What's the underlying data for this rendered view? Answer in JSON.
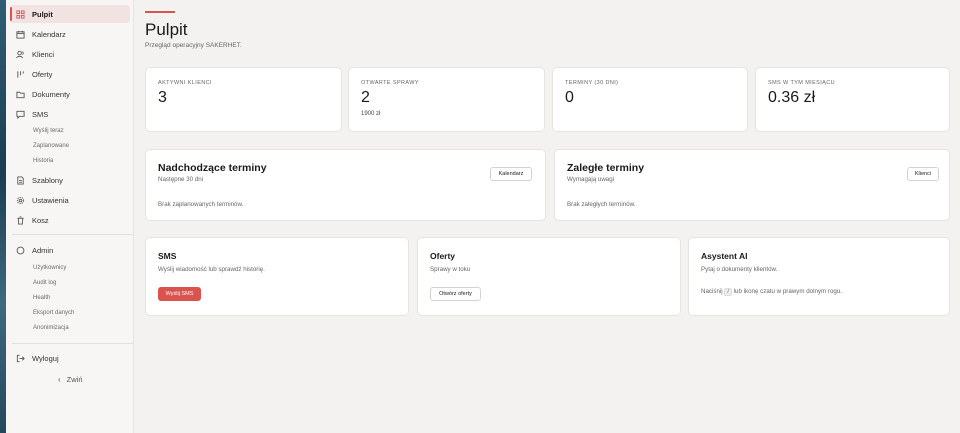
{
  "sidebar": {
    "items": [
      {
        "label": "Pulpit",
        "icon": "dashboard-icon"
      },
      {
        "label": "Kalendarz",
        "icon": "calendar-icon"
      },
      {
        "label": "Klienci",
        "icon": "users-icon"
      },
      {
        "label": "Oferty",
        "icon": "offers-icon"
      },
      {
        "label": "Dokumenty",
        "icon": "folder-icon"
      },
      {
        "label": "SMS",
        "icon": "message-icon"
      }
    ],
    "sms_sub": [
      "Wyślij teraz",
      "Zaplanowane",
      "Historia"
    ],
    "items2": [
      {
        "label": "Szablony",
        "icon": "template-icon"
      },
      {
        "label": "Ustawienia",
        "icon": "gear-icon"
      },
      {
        "label": "Kosz",
        "icon": "trash-icon"
      }
    ],
    "admin": {
      "label": "Admin",
      "icon": "shield-icon"
    },
    "admin_sub": [
      "Użytkownicy",
      "Audit log",
      "Health",
      "Eksport danych",
      "Anonimizacja"
    ],
    "logout": "Wyloguj",
    "collapse": "Zwiń"
  },
  "header": {
    "title": "Pulpit",
    "subtitle": "Przegląd operacyjny SAKERHET."
  },
  "stats": [
    {
      "label": "Aktywni klienci",
      "value": "3",
      "sub": ""
    },
    {
      "label": "Otwarte sprawy",
      "value": "2",
      "sub": "1900 zł"
    },
    {
      "label": "Terminy (30 dni)",
      "value": "0",
      "sub": ""
    },
    {
      "label": "SMS w tym miesiącu",
      "value": "0.36 zł",
      "sub": ""
    }
  ],
  "upcoming": {
    "title": "Nadchodzące terminy",
    "subtitle": "Następne 30 dni",
    "button": "Kalendarz",
    "empty": "Brak zaplanowanych terminów."
  },
  "overdue": {
    "title": "Zaległe terminy",
    "subtitle": "Wymagają uwagi",
    "button": "Klienci",
    "empty": "Brak zaległych terminów."
  },
  "sms_card": {
    "title": "SMS",
    "subtitle": "Wyślij wiadomość lub sprawdź historię.",
    "button": "Wyślij SMS"
  },
  "offers_card": {
    "title": "Oferty",
    "subtitle": "Sprawy w toku",
    "button": "Otwórz oferty"
  },
  "ai_card": {
    "title": "Asystent AI",
    "subtitle": "Pytaj o dokumenty klientów.",
    "hint_prefix": "Naciśnij",
    "hint_key": "/",
    "hint_suffix": "lub ikonę czatu w prawym dolnym rogu."
  },
  "colors": {
    "accent": "#d9534f",
    "background": "#f3f2f0",
    "card": "#ffffff"
  }
}
